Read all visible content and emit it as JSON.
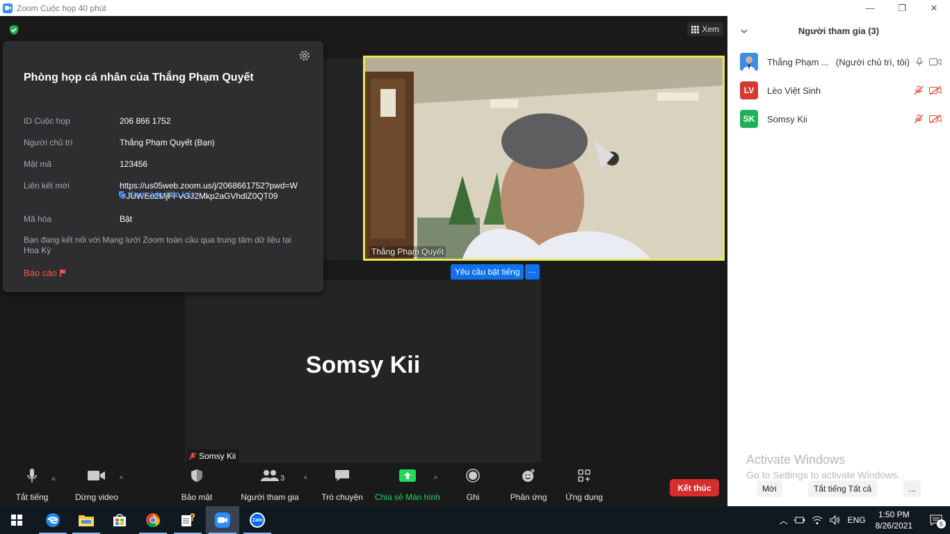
{
  "window": {
    "title": "Zoom Cuộc họp 40 phút",
    "controls": [
      "—",
      "❐",
      "✕"
    ]
  },
  "topbar": {
    "view_label": "Xem"
  },
  "info_popup": {
    "title": "Phòng họp cá nhân của Thắng Phạm Quyết",
    "rows": [
      {
        "label": "ID Cuộc họp",
        "value": "206 866 1752"
      },
      {
        "label": "Người chủ trì",
        "value": "Thắng Phạm Quyết (Bạn)"
      },
      {
        "label": "Mật mã",
        "value": "123456"
      },
      {
        "label": "Liên kết mời",
        "value": "https://us05web.zoom.us/j/2068661752?pwd=WGJUWEo2MjFFVGJ2Mkp2aGVhdlZ0QT09"
      },
      {
        "label": "Mã hóa",
        "value": "Bật"
      }
    ],
    "copy_link": "Sao chép liên kết",
    "note": "Bạn đang kết nối với Mạng lưới Zoom toàn cầu qua trung tâm dữ liệu tại Hoa Kỳ",
    "report": "Báo cáo"
  },
  "video": {
    "active_speaker_name": "Thắng Phạm Quyết",
    "unmute_request": "Yêu cầu bật tiếng",
    "more": "···",
    "somsy_big": "Somsy Kii",
    "somsy_small": "Somsy Kii"
  },
  "toolbar": {
    "mute": "Tắt tiếng",
    "stop_video": "Dừng video",
    "security": "Bảo mật",
    "participants": "Người tham gia",
    "participants_count": "3",
    "chat": "Trò chuyện",
    "share": "Chia sẻ Màn hình",
    "record": "Ghi",
    "reactions": "Phản ứng",
    "apps": "Ứng dụng",
    "end": "Kết thúc",
    "caret": "^"
  },
  "panel": {
    "header": "Người tham gia (3)",
    "participants": [
      {
        "name": "Thắng Phạm ...",
        "role": "(Người chủ trì, tôi)",
        "initials": "",
        "color": "#2d8cff",
        "muted": false
      },
      {
        "name": "Lèo Việt Sinh",
        "role": "",
        "initials": "LV",
        "color": "#d63a2e",
        "muted": true
      },
      {
        "name": "Somsy Kii",
        "role": "",
        "initials": "SK",
        "color": "#1fb15a",
        "muted": true
      }
    ],
    "watermark_title": "Activate Windows",
    "watermark_sub": "Go to Settings to activate Windows.",
    "invite": "Mời",
    "mute_all": "Tắt tiếng Tất cả",
    "more": "..."
  },
  "taskbar": {
    "lang": "ENG",
    "time": "1:50 PM",
    "date": "8/26/2021",
    "notifications": "5",
    "zalo": "Zalo"
  },
  "colors": {
    "accent": "#0e72ed",
    "end": "#d62d2d",
    "share": "#23d959",
    "speaker_border": "#e7e95a"
  }
}
